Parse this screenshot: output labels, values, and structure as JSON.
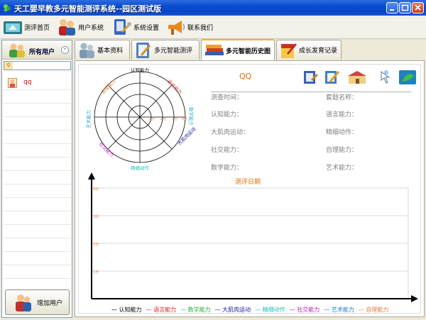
{
  "window": {
    "title": "天工婴早教多元智能测评系统--园区测试版",
    "accent": "#0a4bd1"
  },
  "toolbar": {
    "items": [
      {
        "label": "测评首页",
        "icon": "home-icon"
      },
      {
        "label": "用户系统",
        "icon": "users-icon"
      },
      {
        "label": "系统设置",
        "icon": "settings-icon"
      },
      {
        "label": "联系我们",
        "icon": "megaphone-icon"
      }
    ]
  },
  "sidebar": {
    "title": "所有用户",
    "search_icon": "search-icon",
    "users": [
      {
        "name": "qq"
      }
    ],
    "add_user_label": "增加用户"
  },
  "tabs": [
    {
      "label": "基本资料",
      "icon": "profile-icon"
    },
    {
      "label": "多元智能测评",
      "icon": "clipboard-icon"
    },
    {
      "label": "多元智能历史图",
      "icon": "books-icon",
      "active": true
    },
    {
      "label": "成长发育记录",
      "icon": "notebook-icon"
    }
  ],
  "radar": {
    "labels": [
      "认知能力",
      "语言能力",
      "数学能力",
      "大肌肉运动",
      "精细动作",
      "社交能力",
      "艺术能力",
      "自理能力"
    ],
    "colors": [
      "#000000",
      "#e04040",
      "#30b0d0",
      "#2020a0",
      "#30c0c0",
      "#c020c0",
      "#30a0e0",
      "#e08040"
    ],
    "tick_labels": [
      "1分",
      "2分",
      "3分",
      "4分"
    ]
  },
  "info": {
    "name": "QQ",
    "test_time_label": "测查时间：",
    "cognition_label": "认知能力：",
    "gross_motor_label": "大肌肉运动：",
    "social_label": "社交能力：",
    "math_label": "数学能力：",
    "class_label": "套题名称：",
    "language_label": "语言能力：",
    "fine_motor_label": "精细动作：",
    "self_care_label": "自理能力：",
    "art_label": "艺术能力："
  },
  "chart_data": {
    "type": "line",
    "title": "测评日期",
    "xlabel": "",
    "ylabel": "",
    "ylim": [
      0,
      4
    ],
    "y_ticks": [
      "1分",
      "2分",
      "3分",
      "4分"
    ],
    "x": [],
    "series": [
      {
        "name": "认知能力",
        "color": "#000000",
        "values": []
      },
      {
        "name": "语言能力",
        "color": "#e02020",
        "values": []
      },
      {
        "name": "数学能力",
        "color": "#20b040",
        "values": []
      },
      {
        "name": "大肌肉运动",
        "color": "#2020a0",
        "values": []
      },
      {
        "name": "精细动作",
        "color": "#20c0c0",
        "values": []
      },
      {
        "name": "社交能力",
        "color": "#c020c0",
        "values": []
      },
      {
        "name": "艺术能力",
        "color": "#2080e0",
        "values": []
      },
      {
        "name": "自理能力",
        "color": "#e08040",
        "values": []
      }
    ],
    "grid": true,
    "legend": "bottom"
  }
}
